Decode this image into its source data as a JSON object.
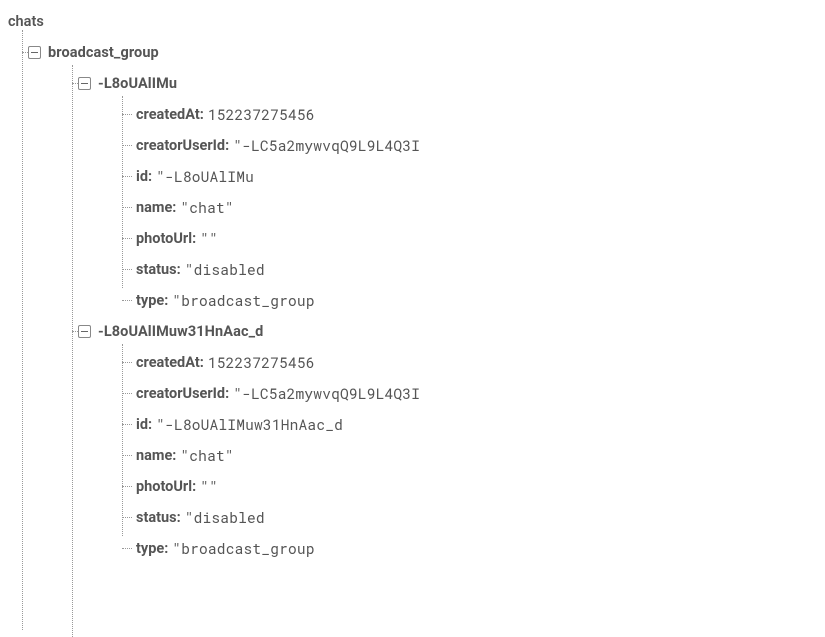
{
  "root": {
    "label": "chats",
    "children": [
      {
        "label": "broadcast_group",
        "children": [
          {
            "label": "-L8oUAlIMu",
            "props": [
              {
                "key": "createdAt",
                "value": "152237275456"
              },
              {
                "key": "creatorUserId",
                "value": "\"-LC5a2mywvqQ9L9L4Q3I"
              },
              {
                "key": "id",
                "value": "\"-L8oUAlIMu"
              },
              {
                "key": "name",
                "value": "\"chat\""
              },
              {
                "key": "photoUrl",
                "value": "\"\""
              },
              {
                "key": "status",
                "value": "\"disabled"
              },
              {
                "key": "type",
                "value": "\"broadcast_group"
              }
            ]
          },
          {
            "label": "-L8oUAlIMuw31HnAac_d",
            "props": [
              {
                "key": "createdAt",
                "value": "152237275456"
              },
              {
                "key": "creatorUserId",
                "value": "\"-LC5a2mywvqQ9L9L4Q3I"
              },
              {
                "key": "id",
                "value": "\"-L8oUAlIMuw31HnAac_d"
              },
              {
                "key": "name",
                "value": "\"chat\""
              },
              {
                "key": "photoUrl",
                "value": "\"\""
              },
              {
                "key": "status",
                "value": "\"disabled"
              },
              {
                "key": "type",
                "value": "\"broadcast_group"
              }
            ]
          }
        ]
      }
    ]
  }
}
